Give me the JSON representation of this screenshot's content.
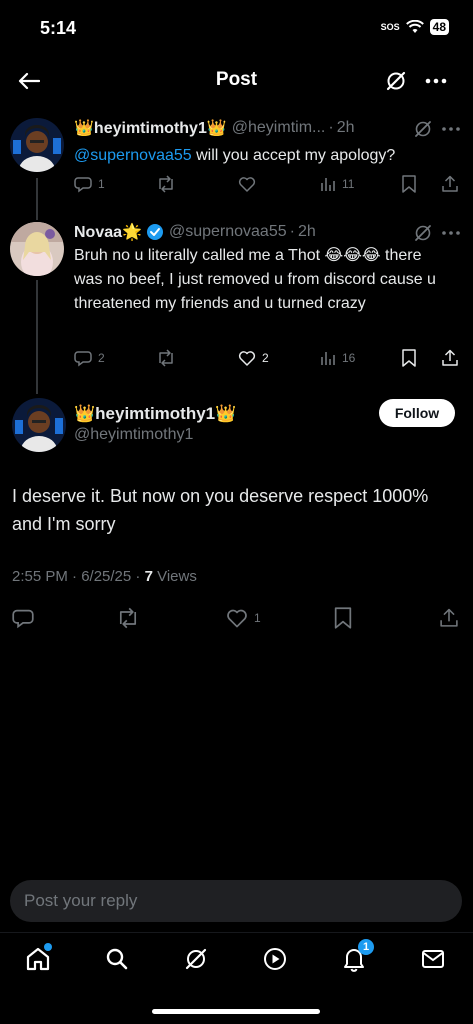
{
  "status": {
    "time": "5:14",
    "sos": "SOS",
    "battery": "48"
  },
  "topbar": {
    "title": "Post"
  },
  "tweets": [
    {
      "name": "👑heyimtimothy1👑",
      "handle": "@heyimtim...",
      "sep": "·",
      "time": "2h",
      "mention": "@supernovaa55",
      "text": " will you accept my apology?",
      "replies": "1",
      "retweets": "",
      "likes": "",
      "views": "11"
    },
    {
      "name": "Novaa🌟",
      "handle": "@supernovaa55",
      "sep": "·",
      "time": "2h",
      "text": "Bruh no u literally called me a Thot 😂😂😂 there was no beef, I just removed u from discord cause u threatened my friends and u turned crazy",
      "replies": "2",
      "retweets": "",
      "likes": "2",
      "views": "16"
    }
  ],
  "main": {
    "name": "👑heyimtimothy1👑",
    "handle": "@heyimtimothy1",
    "follow_label": "Follow",
    "text": "I deserve it. But now on you deserve respect 1000% and I'm sorry",
    "timestamp": "2:55 PM · 6/25/25 · ",
    "views_count": "7",
    "views_label": " Views",
    "likes": "1"
  },
  "reply": {
    "placeholder": "Post your reply"
  },
  "nav": {
    "notifications_badge": "1"
  },
  "colors": {
    "accent": "#1d9bf0",
    "background": "#000000",
    "muted": "#71767b"
  }
}
